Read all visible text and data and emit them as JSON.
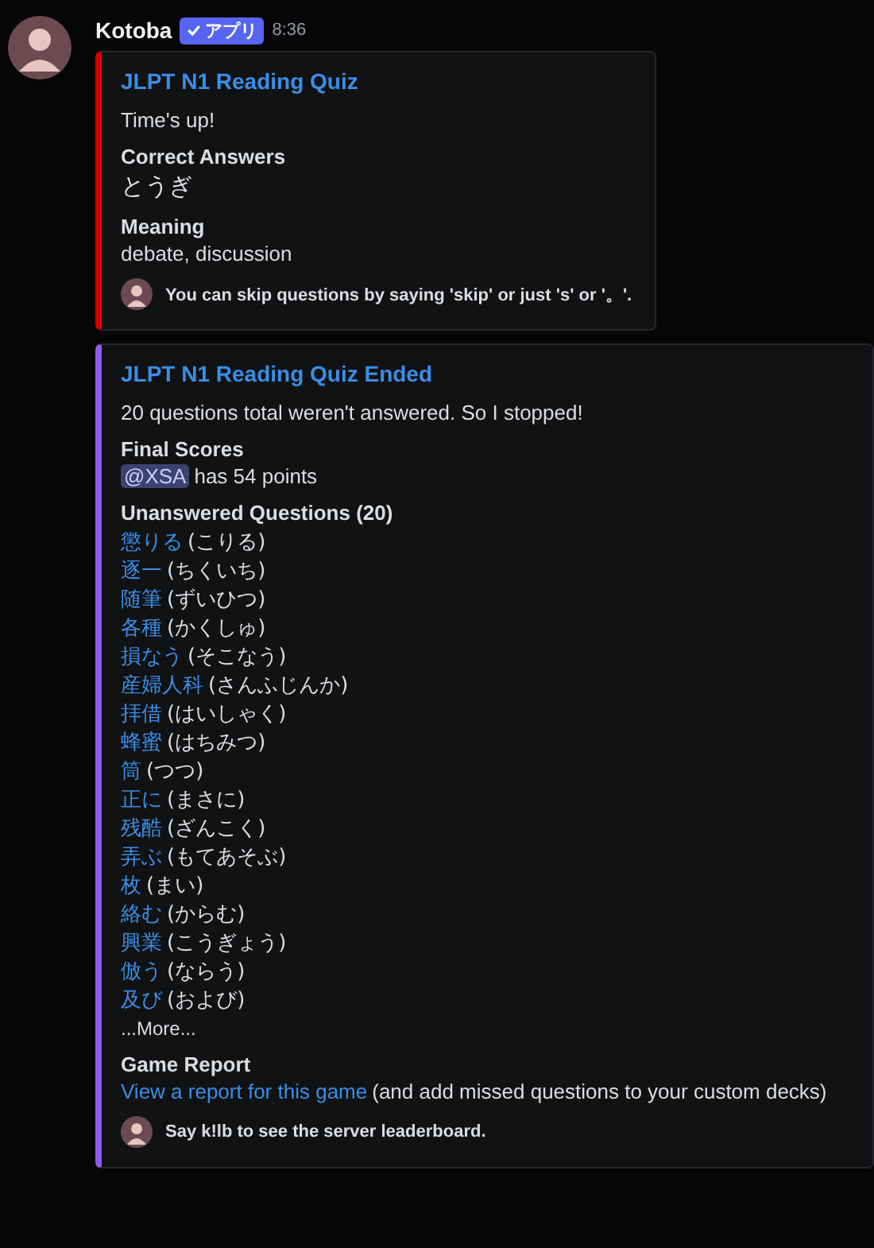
{
  "message": {
    "author": "Kotoba",
    "badge": "アプリ",
    "time": "8:36"
  },
  "embeds": [
    {
      "color": "#d40000",
      "title": "JLPT N1 Reading Quiz",
      "description": "Time's up!",
      "fields": [
        {
          "kind": "kana",
          "name": "Correct Answers",
          "value": "とうぎ"
        },
        {
          "kind": "text",
          "name": "Meaning",
          "value": "debate, discussion"
        }
      ],
      "footer": "You can skip questions by saying 'skip' or just 's' or '。'."
    },
    {
      "color": "#8c5cf0",
      "title": "JLPT N1 Reading Quiz Ended",
      "description": "20 questions total weren't answered. So I stopped!",
      "fields": [
        {
          "kind": "mention",
          "name": "Final Scores",
          "mention": "@XSA",
          "value": "has 54 points"
        },
        {
          "kind": "list",
          "name": "Unanswered Questions (20)",
          "items": [
            {
              "word": "懲りる",
              "reading": "(こりる)"
            },
            {
              "word": "逐一",
              "reading": "(ちくいち)"
            },
            {
              "word": "随筆",
              "reading": "(ずいひつ)"
            },
            {
              "word": "各種",
              "reading": "(かくしゅ)"
            },
            {
              "word": "損なう",
              "reading": "(そこなう)"
            },
            {
              "word": "産婦人科",
              "reading": "(さんふじんか)"
            },
            {
              "word": "拝借",
              "reading": "(はいしゃく)"
            },
            {
              "word": "蜂蜜",
              "reading": "(はちみつ)"
            },
            {
              "word": "筒",
              "reading": "(つつ)"
            },
            {
              "word": "正に",
              "reading": "(まさに)"
            },
            {
              "word": "残酷",
              "reading": "(ざんこく)"
            },
            {
              "word": "弄ぶ",
              "reading": "(もてあそぶ)"
            },
            {
              "word": "枚",
              "reading": "(まい)"
            },
            {
              "word": "絡む",
              "reading": "(からむ)"
            },
            {
              "word": "興業",
              "reading": "(こうぎょう)"
            },
            {
              "word": "倣う",
              "reading": "(ならう)"
            },
            {
              "word": "及び",
              "reading": "(および)"
            }
          ],
          "more": "...More..."
        },
        {
          "kind": "link",
          "name": "Game Report",
          "link": "View a report for this game",
          "value": "(and add missed questions to your custom decks)"
        }
      ],
      "footer": "Say k!lb to see the server leaderboard."
    }
  ]
}
